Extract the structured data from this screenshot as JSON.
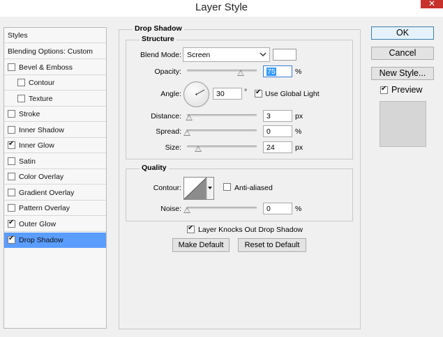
{
  "window": {
    "title": "Layer Style",
    "close_glyph": "✕"
  },
  "styles_list": {
    "header": "Styles",
    "blending_options": "Blending Options: Custom",
    "items": [
      {
        "label": "Bevel & Emboss",
        "checked": false
      },
      {
        "label": "Contour",
        "checked": false
      },
      {
        "label": "Texture",
        "checked": false
      },
      {
        "label": "Stroke",
        "checked": false
      },
      {
        "label": "Inner Shadow",
        "checked": false
      },
      {
        "label": "Inner Glow",
        "checked": true
      },
      {
        "label": "Satin",
        "checked": false
      },
      {
        "label": "Color Overlay",
        "checked": false
      },
      {
        "label": "Gradient Overlay",
        "checked": false
      },
      {
        "label": "Pattern Overlay",
        "checked": false
      },
      {
        "label": "Outer Glow",
        "checked": true
      },
      {
        "label": "Drop Shadow",
        "checked": true,
        "selected": true
      }
    ]
  },
  "drop_shadow": {
    "title": "Drop Shadow",
    "structure": {
      "title": "Structure",
      "blend_mode_label": "Blend Mode:",
      "blend_mode_value": "Screen",
      "shadow_color": "#ffffff",
      "opacity_label": "Opacity:",
      "opacity_value": "75",
      "opacity_unit": "%",
      "angle_label": "Angle:",
      "angle_value": "30",
      "angle_unit": "°",
      "use_global_light_label": "Use Global Light",
      "use_global_light_checked": true,
      "distance_label": "Distance:",
      "distance_value": "3",
      "distance_unit": "px",
      "spread_label": "Spread:",
      "spread_value": "0",
      "spread_unit": "%",
      "size_label": "Size:",
      "size_value": "24",
      "size_unit": "px"
    },
    "quality": {
      "title": "Quality",
      "contour_label": "Contour:",
      "anti_aliased_label": "Anti-aliased",
      "anti_aliased_checked": false,
      "noise_label": "Noise:",
      "noise_value": "0",
      "noise_unit": "%"
    },
    "layer_knocks_out_label": "Layer Knocks Out Drop Shadow",
    "layer_knocks_out_checked": true,
    "make_default_label": "Make Default",
    "reset_default_label": "Reset to Default"
  },
  "actions": {
    "ok_label": "OK",
    "cancel_label": "Cancel",
    "new_style_label": "New Style...",
    "preview_label": "Preview",
    "preview_checked": true
  },
  "icons": {
    "dropdown": "chevron-down-icon",
    "checkmark": "checkmark-icon",
    "close": "close-icon"
  },
  "colors": {
    "selected_row": "#5b9dfe",
    "close_button": "#c7302b",
    "ok_border": "#3c7fb1"
  }
}
